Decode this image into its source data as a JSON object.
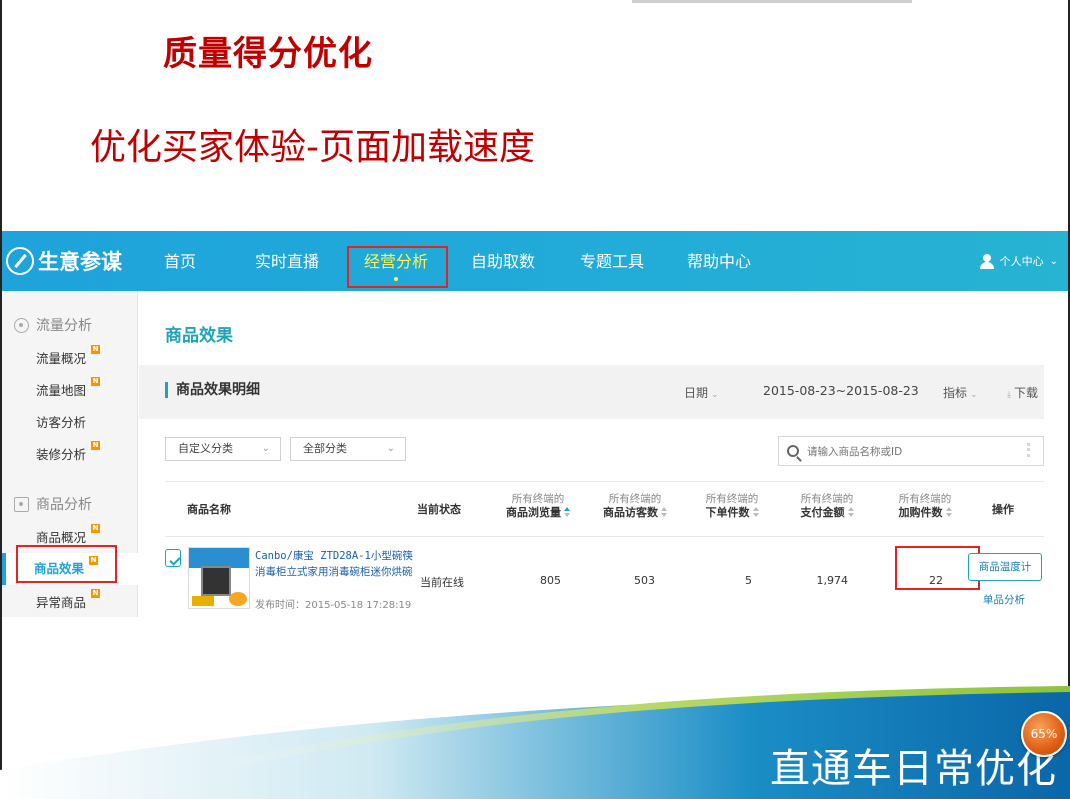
{
  "slide": {
    "title": "质量得分优化",
    "subtitle": "优化买家体验-页面加载速度",
    "bottom_caption": "直通车日常优化",
    "progress_percent": "65%"
  },
  "app": {
    "logo": "生意参谋",
    "nav": [
      "首页",
      "实时直播",
      "经营分析",
      "自助取数",
      "专题工具",
      "帮助中心"
    ],
    "active_nav": "经营分析",
    "user_center": "个人中心",
    "sidebar": {
      "groups": [
        {
          "label": "流量分析",
          "items": [
            {
              "label": "流量概况",
              "badge": "N"
            },
            {
              "label": "流量地图",
              "badge": "N"
            },
            {
              "label": "访客分析",
              "badge": ""
            },
            {
              "label": "装修分析",
              "badge": "N"
            }
          ]
        },
        {
          "label": "商品分析",
          "items": [
            {
              "label": "商品概况",
              "badge": "N"
            },
            {
              "label": "商品效果",
              "badge": "N"
            },
            {
              "label": "异常商品",
              "badge": "N"
            }
          ]
        }
      ],
      "active_item": "商品效果"
    },
    "main": {
      "page_title": "商品效果",
      "section_title": "商品效果明细",
      "date_label": "日期",
      "date_range": "2015-08-23~2015-08-23",
      "metric_label": "指标",
      "download_label": "下载",
      "filter_custom": "自定义分类",
      "filter_all": "全部分类",
      "search_placeholder": "请输入商品名称或ID",
      "columns": {
        "name": "商品名称",
        "status": "当前状态",
        "metric_prefix": "所有终端的",
        "views": "商品浏览量",
        "visitors": "商品访客数",
        "orders": "下单件数",
        "pay_amount": "支付金额",
        "cart": "加购件数",
        "ops": "操作"
      },
      "rows": [
        {
          "name": "Canbo/康宝 ZTD28A-1小型碗筷消毒柜立式家用消毒碗柜迷你烘碗",
          "publish_time": "发布时间：2015-05-18 17:28:19",
          "status": "当前在线",
          "views": "805",
          "visitors": "503",
          "orders": "5",
          "pay_amount": "1,974",
          "cart": "22",
          "op_button": "商品温度计",
          "op_link": "单品分析"
        }
      ]
    }
  },
  "colors": {
    "title_red": "#c00000",
    "nav_blue": "#1ea3db",
    "highlight_red": "#e32420",
    "active_nav_yellow": "#fff64d"
  }
}
